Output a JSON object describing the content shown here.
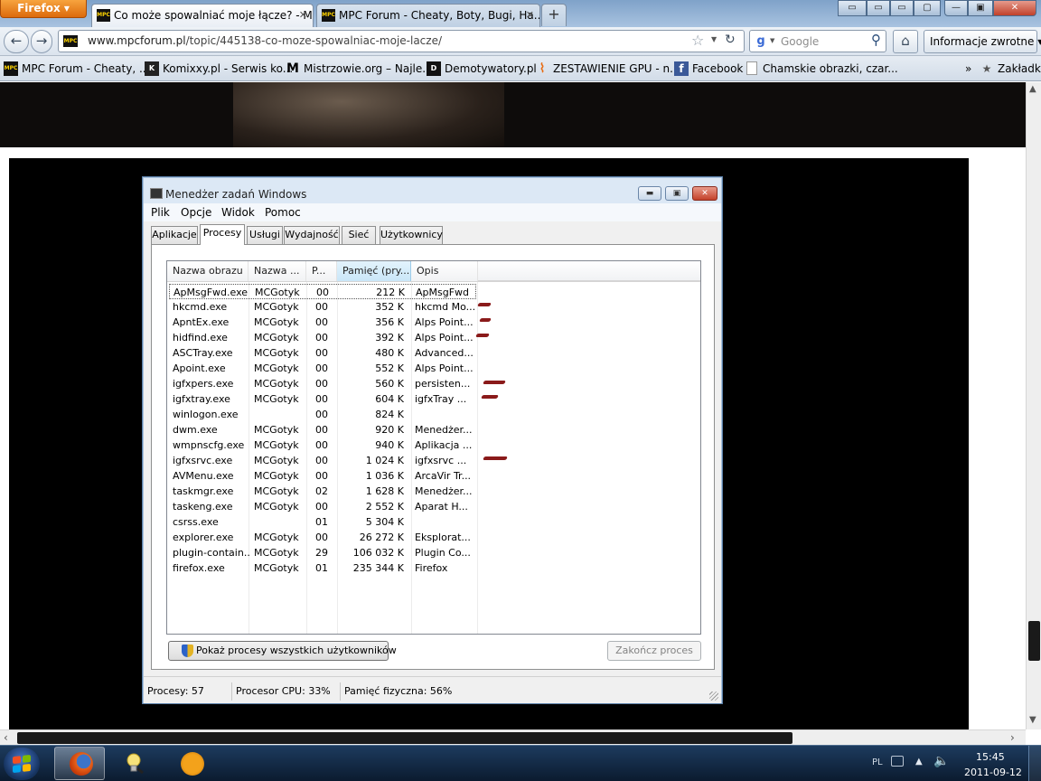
{
  "browser": {
    "menu_button": "Firefox",
    "tabs": [
      {
        "title": "Co może spowalniać moje łącze? - M...",
        "favicon": "MPC"
      },
      {
        "title": "MPC Forum - Cheaty, Boty, Bugi, Ha...",
        "favicon": "MPC"
      }
    ],
    "url": "www.mpcforum.pl/topic/445138-co-moze-spowalniac-moje-lacze/",
    "url_domain": "www.mpcforum.pl",
    "url_path": "/topic/445138-co-moze-spowalniac-moje-lacze/",
    "search_engine": "g",
    "search_placeholder": "Google",
    "feedback_button": "Informacje zwrotne",
    "bookmarks": [
      {
        "label": "MPC Forum - Cheaty, ...",
        "icon": "MPC"
      },
      {
        "label": "Komixxy.pl - Serwis ko...",
        "icon": "K"
      },
      {
        "label": "Mistrzowie.org – Najle...",
        "icon": "M"
      },
      {
        "label": "Demotywatory.pl",
        "icon": "D"
      },
      {
        "label": "ZESTAWIENIE GPU - n...",
        "icon": "~"
      },
      {
        "label": "Facebook",
        "icon": "f"
      },
      {
        "label": "Chamskie obrazki, czar...",
        "icon": ""
      }
    ],
    "bookmarks_folder": "Zakładki"
  },
  "taskmgr": {
    "title": "Menedżer zadań Windows",
    "menu": [
      "Plik",
      "Opcje",
      "Widok",
      "Pomoc"
    ],
    "tabs": [
      "Aplikacje",
      "Procesy",
      "Usługi",
      "Wydajność",
      "Sieć",
      "Użytkownicy"
    ],
    "active_tab": "Procesy",
    "columns": [
      "Nazwa obrazu",
      "Nazwa ...",
      "P...",
      "Pamięć (pry...",
      "Opis"
    ],
    "rows": [
      {
        "name": "ApMsgFwd.exe",
        "user": "MCGotyk",
        "p": "00",
        "mem": "212 K",
        "desc": "ApMsgFwd"
      },
      {
        "name": "hkcmd.exe",
        "user": "MCGotyk",
        "p": "00",
        "mem": "352 K",
        "desc": "hkcmd Mo..."
      },
      {
        "name": "ApntEx.exe",
        "user": "MCGotyk",
        "p": "00",
        "mem": "356 K",
        "desc": "Alps Point..."
      },
      {
        "name": "hidfind.exe",
        "user": "MCGotyk",
        "p": "00",
        "mem": "392 K",
        "desc": "Alps Point..."
      },
      {
        "name": "ASCTray.exe",
        "user": "MCGotyk",
        "p": "00",
        "mem": "480 K",
        "desc": "Advanced..."
      },
      {
        "name": "Apoint.exe",
        "user": "MCGotyk",
        "p": "00",
        "mem": "552 K",
        "desc": "Alps Point..."
      },
      {
        "name": "igfxpers.exe",
        "user": "MCGotyk",
        "p": "00",
        "mem": "560 K",
        "desc": "persisten..."
      },
      {
        "name": "igfxtray.exe",
        "user": "MCGotyk",
        "p": "00",
        "mem": "604 K",
        "desc": "igfxTray ..."
      },
      {
        "name": "winlogon.exe",
        "user": "",
        "p": "00",
        "mem": "824 K",
        "desc": ""
      },
      {
        "name": "dwm.exe",
        "user": "MCGotyk",
        "p": "00",
        "mem": "920 K",
        "desc": "Menedżer..."
      },
      {
        "name": "wmpnscfg.exe",
        "user": "MCGotyk",
        "p": "00",
        "mem": "940 K",
        "desc": "Aplikacja ..."
      },
      {
        "name": "igfxsrvc.exe",
        "user": "MCGotyk",
        "p": "00",
        "mem": "1 024 K",
        "desc": "igfxsrvc ..."
      },
      {
        "name": "AVMenu.exe",
        "user": "MCGotyk",
        "p": "00",
        "mem": "1 036 K",
        "desc": "ArcaVir Tr..."
      },
      {
        "name": "taskmgr.exe",
        "user": "MCGotyk",
        "p": "02",
        "mem": "1 628 K",
        "desc": "Menedżer..."
      },
      {
        "name": "taskeng.exe",
        "user": "MCGotyk",
        "p": "00",
        "mem": "2 552 K",
        "desc": "Aparat H..."
      },
      {
        "name": "csrss.exe",
        "user": "",
        "p": "01",
        "mem": "5 304 K",
        "desc": ""
      },
      {
        "name": "explorer.exe",
        "user": "MCGotyk",
        "p": "00",
        "mem": "26 272 K",
        "desc": "Eksplorat..."
      },
      {
        "name": "plugin-contain...",
        "user": "MCGotyk",
        "p": "29",
        "mem": "106 032 K",
        "desc": "Plugin Co..."
      },
      {
        "name": "firefox.exe",
        "user": "MCGotyk",
        "p": "01",
        "mem": "235 344 K",
        "desc": "Firefox"
      }
    ],
    "show_all_button": "Pokaż procesy wszystkich użytkowników",
    "end_process_button": "Zakończ proces",
    "status": {
      "processes": "Procesy: 57",
      "cpu": "Procesor CPU: 33%",
      "memory": "Pamięć fizyczna: 56%"
    }
  },
  "taskbar": {
    "language": "PL",
    "time": "15:45",
    "date": "2011-09-12"
  },
  "colors": {
    "firefox_orange": "#e47811",
    "annotation_red": "#8a1a1a",
    "taskbar": "#132a45"
  },
  "icons": [
    "back-arrow-icon",
    "forward-arrow-icon",
    "star-icon",
    "reload-icon",
    "search-icon",
    "home-icon",
    "windows-start-icon",
    "firefox-icon",
    "bulb-icon",
    "avast-icon",
    "shield-icon",
    "volume-icon"
  ]
}
